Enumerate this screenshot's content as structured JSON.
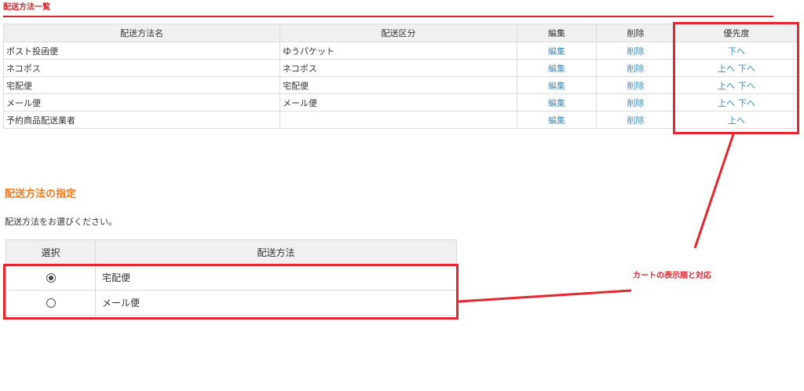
{
  "list_section": {
    "title": "配送方法一覧",
    "headers": {
      "name": "配送方法名",
      "category": "配送区分",
      "edit": "編集",
      "delete": "削除",
      "priority": "優先度"
    },
    "rows": [
      {
        "name": "ポスト投函便",
        "category": "ゆうパケット",
        "edit": "編集",
        "delete": "削除",
        "up": "",
        "down": "下へ"
      },
      {
        "name": "ネコポス",
        "category": "ネコポス",
        "edit": "編集",
        "delete": "削除",
        "up": "上へ",
        "down": "下へ"
      },
      {
        "name": "宅配便",
        "category": "宅配便",
        "edit": "編集",
        "delete": "削除",
        "up": "上へ",
        "down": "下へ"
      },
      {
        "name": "メール便",
        "category": "メール便",
        "edit": "編集",
        "delete": "削除",
        "up": "上へ",
        "down": "下へ"
      },
      {
        "name": "予約商品配送業者",
        "category": "",
        "edit": "編集",
        "delete": "削除",
        "up": "上へ",
        "down": ""
      }
    ]
  },
  "spec_section": {
    "title": "配送方法の指定",
    "description": "配送方法をお選びください。",
    "headers": {
      "select": "選択",
      "method": "配送方法"
    },
    "options": [
      {
        "label": "宅配便",
        "selected": true
      },
      {
        "label": "メール便",
        "selected": false
      }
    ]
  },
  "annotation": {
    "label": "カートの表示順と対応",
    "color": "#e32630"
  },
  "colors": {
    "title_red": "#d6262b",
    "spec_title_orange": "#f07a1d",
    "link_blue": "#3c8dbc",
    "header_bg": "#f0f0f0"
  }
}
